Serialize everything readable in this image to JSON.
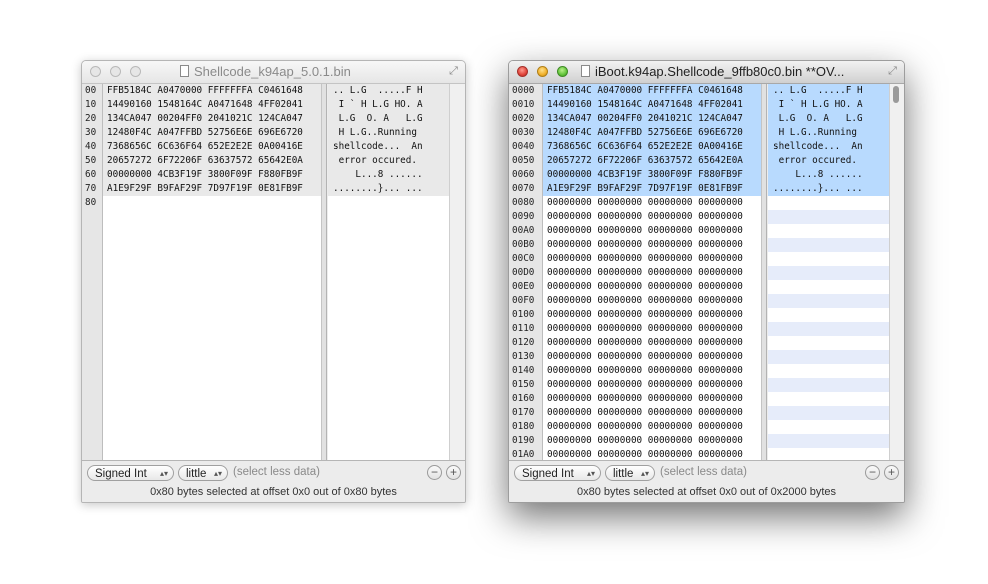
{
  "window1": {
    "title": "Shellcode_k94ap_5.0.1.bin",
    "offsets": [
      "00",
      "10",
      "20",
      "30",
      "40",
      "50",
      "60",
      "70",
      "80"
    ],
    "hex_rows": [
      "FFB5184C A0470000 FFFFFFFA C0461648",
      "14490160 1548164C A0471648 4FF02041",
      "134CA047 00204FF0 2041021C 124CA047",
      "12480F4C A047FFBD 52756E6E 696E6720",
      "7368656C 6C636F64 652E2E2E 0A00416E",
      "20657272 6F72206F 63637572 65642E0A",
      "00000000 4CB3F19F 3800F09F F880FB9F",
      "A1E9F29F B9FAF29F 7D97F19F 0E81FB9F"
    ],
    "ascii_rows": [
      ".. L.G  .....F H",
      " I ` H L.G HO. A",
      " L.G  O. A   L.G",
      " H L.G..Running ",
      "shellcode...  An",
      " error occured. ",
      "    L...8 ......",
      "........}... ..."
    ],
    "type_select": "Signed Int",
    "endian_select": "little",
    "hint": "(select less data)",
    "status": "0x80 bytes selected at offset 0x0 out of 0x80 bytes"
  },
  "window2": {
    "title": "iBoot.k94ap.Shellcode_9ffb80c0.bin **OV...",
    "offsets": [
      "0000",
      "0010",
      "0020",
      "0030",
      "0040",
      "0050",
      "0060",
      "0070",
      "0080",
      "0090",
      "00A0",
      "00B0",
      "00C0",
      "00D0",
      "00E0",
      "00F0",
      "0100",
      "0110",
      "0120",
      "0130",
      "0140",
      "0150",
      "0160",
      "0170",
      "0180",
      "0190",
      "01A0"
    ],
    "hex_rows": [
      "FFB5184C A0470000 FFFFFFFA C0461648",
      "14490160 1548164C A0471648 4FF02041",
      "134CA047 00204FF0 2041021C 124CA047",
      "12480F4C A047FFBD 52756E6E 696E6720",
      "7368656C 6C636F64 652E2E2E 0A00416E",
      "20657272 6F72206F 63637572 65642E0A",
      "00000000 4CB3F19F 3800F09F F880FB9F",
      "A1E9F29F B9FAF29F 7D97F19F 0E81FB9F"
    ],
    "zero_row": "00000000 00000000 00000000 00000000",
    "ascii_rows": [
      ".. L.G  .....F H",
      " I ` H L.G HO. A",
      " L.G  O. A   L.G",
      " H L.G..Running ",
      "shellcode...  An",
      " error occured. ",
      "    L...8 ......",
      "........}... ..."
    ],
    "type_select": "Signed Int",
    "endian_select": "little",
    "hint": "(select less data)",
    "status": "0x80 bytes selected at offset 0x0 out of 0x2000 bytes"
  },
  "icons": {
    "minus": "−",
    "plus": "+",
    "popup_arrows": "▴▾",
    "expand": "⤢"
  },
  "colors": {
    "selection_active": "#b8dafe",
    "selection_inactive": "#e9e9e9",
    "ascii_stripe": "#e6ecfa"
  }
}
